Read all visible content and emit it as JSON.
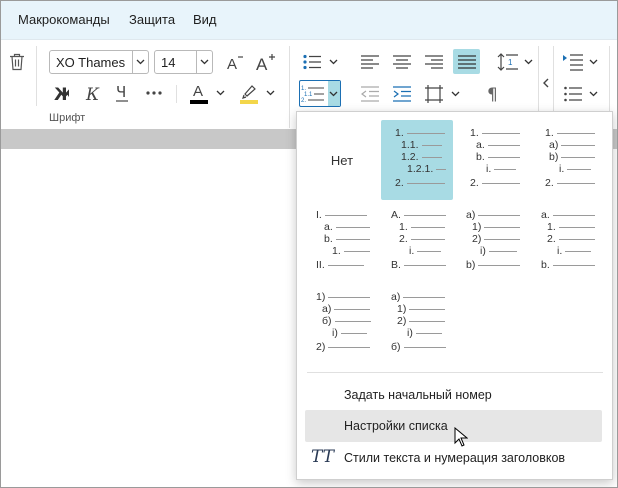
{
  "menubar": {
    "items": [
      {
        "label": "Макрокоманды"
      },
      {
        "label": "Защита"
      },
      {
        "label": "Вид"
      }
    ]
  },
  "ribbon": {
    "font_group_label": "Шрифт",
    "font_name": "XO Thames",
    "font_size": "14",
    "text_color": "#000000",
    "highlight_color": "#f3d64a"
  },
  "numbering_dropdown": {
    "none_label": "Нет",
    "styles": [
      {
        "id": "none",
        "selected": false,
        "lines": []
      },
      {
        "id": "multilevel-decimal",
        "selected": true,
        "lines": [
          "1.",
          "1.1.",
          "1.2.",
          "1.2.1.",
          "2."
        ]
      },
      {
        "id": "decimal-letter-roman",
        "selected": false,
        "lines": [
          "1.",
          "a.",
          "b.",
          "i.",
          "2."
        ]
      },
      {
        "id": "decimal-paren-letter",
        "selected": false,
        "lines": [
          "1.",
          "a)",
          "b)",
          "i.",
          "2."
        ]
      },
      {
        "id": "upper-roman",
        "selected": false,
        "lines": [
          "I.",
          "a.",
          "b.",
          "1.",
          "II."
        ]
      },
      {
        "id": "upper-letter",
        "selected": false,
        "lines": [
          "A.",
          "1.",
          "2.",
          "i.",
          "B."
        ]
      },
      {
        "id": "lower-letter-paren",
        "selected": false,
        "lines": [
          "a)",
          "1)",
          "2)",
          "i)",
          "b)"
        ]
      },
      {
        "id": "lower-letter-dot",
        "selected": false,
        "lines": [
          "a.",
          "1.",
          "2.",
          "i.",
          "b."
        ]
      },
      {
        "id": "decimal-paren-cyrillic",
        "selected": false,
        "lines": [
          "1)",
          "а)",
          "б)",
          "i)",
          "2)"
        ]
      },
      {
        "id": "cyrillic-paren",
        "selected": false,
        "lines": [
          "а)",
          "1)",
          "2)",
          "i)",
          "б)"
        ]
      }
    ],
    "menu": [
      {
        "label": "Задать начальный номер",
        "hover": false
      },
      {
        "label": "Настройки списка",
        "hover": true
      },
      {
        "label": "Стили текста и нумерация заголовков",
        "hover": false
      }
    ]
  }
}
